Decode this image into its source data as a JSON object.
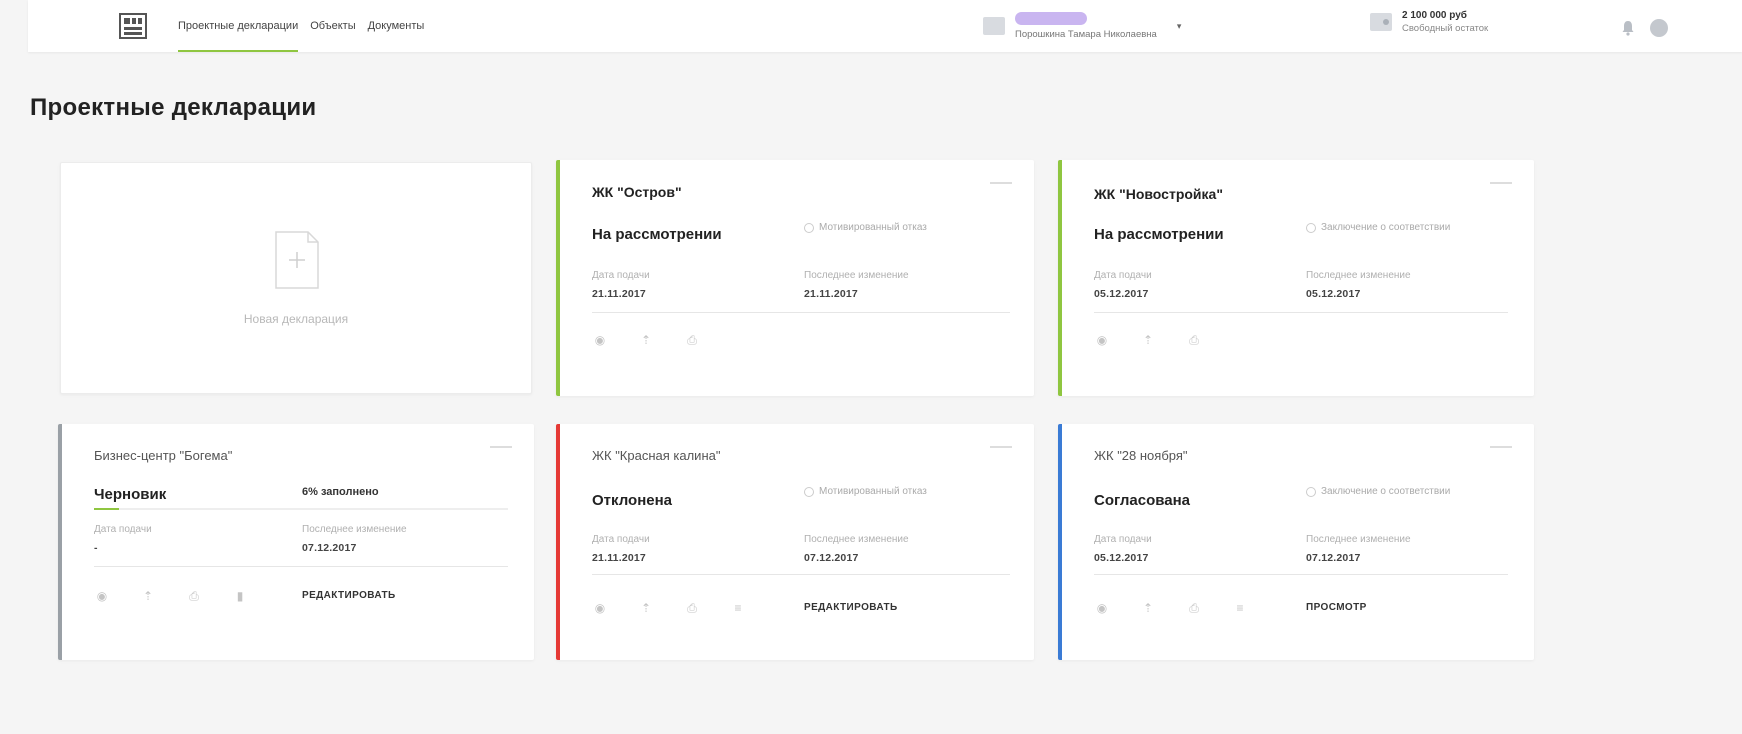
{
  "nav": {
    "items": [
      {
        "label": "Проектные декларации",
        "active": true
      },
      {
        "label": "Объекты",
        "active": false
      },
      {
        "label": "Документы",
        "active": false
      }
    ]
  },
  "user": {
    "name": "Порошкина Тамара Николаевна"
  },
  "balance": {
    "amount": "2 100 000 руб",
    "label": "Свободный остаток"
  },
  "page": {
    "title": "Проектные декларации"
  },
  "new_card": {
    "label": "Новая декларация"
  },
  "labels": {
    "submit_date": "Дата подачи",
    "last_change": "Последнее изменение"
  },
  "cards": [
    {
      "title": "ЖК \"Остров\"",
      "status": "На рассмотрении",
      "note": "Мотивированный отказ",
      "submit_date": "21.11.2017",
      "last_change": "21.11.2017",
      "accent": "#8fc640"
    },
    {
      "title": "ЖК \"Новостройка\"",
      "status": "На рассмотрении",
      "note": "Заключение о соответствии",
      "submit_date": "05.12.2017",
      "last_change": "05.12.2017",
      "accent": "#8fc640"
    },
    {
      "title": "Бизнес-центр \"Богема\"",
      "status": "Черновик",
      "progress_label": "6% заполнено",
      "progress": 0.06,
      "submit_date": "-",
      "last_change": "07.12.2017",
      "action": "РЕДАКТИРОВАТЬ",
      "accent": "#9aa0a6"
    },
    {
      "title": "ЖК \"Красная калина\"",
      "status": "Отклонена",
      "note": "Мотивированный отказ",
      "submit_date": "21.11.2017",
      "last_change": "07.12.2017",
      "action": "РЕДАКТИРОВАТЬ",
      "accent": "#e53935"
    },
    {
      "title": "ЖК \"28 ноября\"",
      "status": "Согласована",
      "note": "Заключение о соответствии",
      "submit_date": "05.12.2017",
      "last_change": "07.12.2017",
      "action": "ПРОСМОТР",
      "accent": "#3a7bd5"
    }
  ]
}
